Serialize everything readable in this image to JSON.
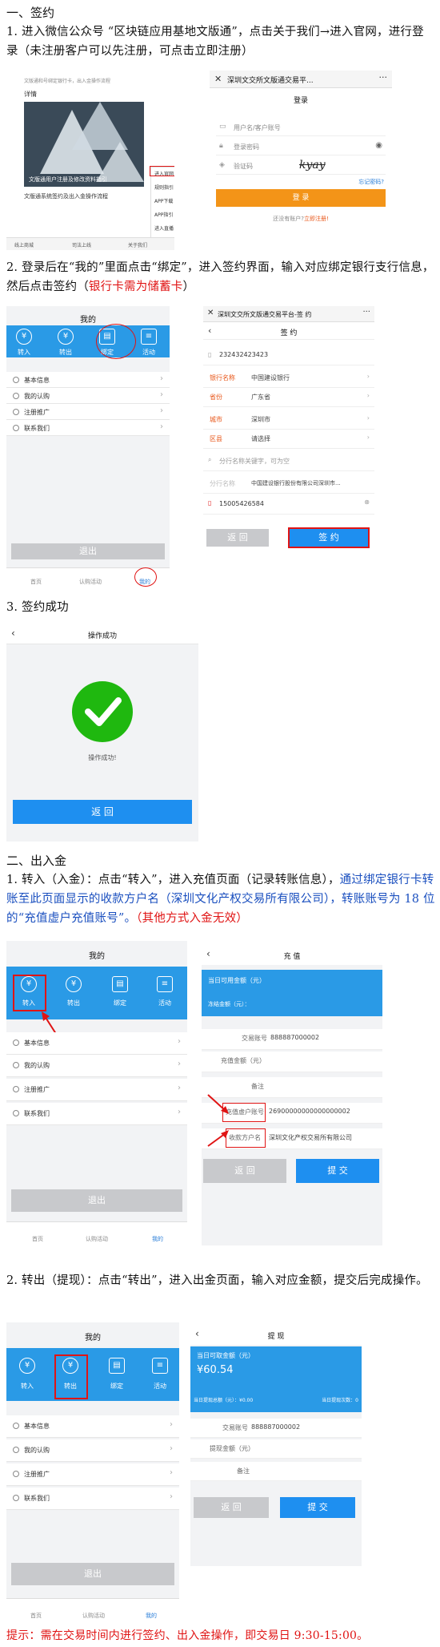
{
  "s1": {
    "heading": "一、签约",
    "p1": "1. 进入微信公众号 “区块链应用基地文版通”，点击关于我们→进入官网，进行登录（未注册客户可以先注册，可点击立即注册）",
    "p2a": "2. 登录后在“我的”里面点击“绑定”，进入签约界面，输入对应绑定银行支行信息，然后点击签约（",
    "p2red": "银行卡需为储蓄卡",
    "p2b": "）",
    "p3": "3. 签约成功"
  },
  "s2": {
    "heading": "二、出入金",
    "p1a": "1. 转入（入金）：点击“转入”，进入充值页面（记录转账信息），",
    "p1blue": "通过绑定银行卡转账至此页面显示的收款方户名（深圳文化产权交易所有限公司），转账账号为 18 位的“充值虚户充值账号”。",
    "p1red": "（其他方式入金无效）",
    "p2": "2. 转出（提现）：点击“转出”，进入出金页面，输入对应金额，提交后完成操作。"
  },
  "tip": "提示：需在交易时间内进行签约、出入金操作，即交易日 9:30-15:00。",
  "wx": {
    "line1": "文版通和号绑定银行卡，出入金操作流程",
    "detail": "详情",
    "banner": "文版通用户注册及修改资料指引",
    "sub": "文版通系统签约及出入金操作流程",
    "menu": [
      "进入官网",
      "规则指引",
      "APP下载",
      "APP指引",
      "进入直播"
    ],
    "tabs": [
      "线上商城",
      "司法上线",
      "关于我们"
    ]
  },
  "login": {
    "title": "深圳文交所文版通交易平...",
    "head": "登录",
    "user": "用户名/客户账号",
    "pwd": "登录密码",
    "code": "验证码",
    "captcha": "kyay",
    "forgot": "忘记密码?",
    "btn": "登 录",
    "reg_a": "还没有账户?",
    "reg_b": "立即注册!"
  },
  "mine": {
    "title": "我的",
    "icons": [
      "转入",
      "转出",
      "绑定",
      "活动"
    ],
    "rows": [
      "基本信息",
      "我的认购",
      "注册推广",
      "联系我们"
    ],
    "logout": "退出",
    "tabs": [
      "首页",
      "认购活动",
      "我的"
    ]
  },
  "sign": {
    "title": "深圳文交所文版通交易平台-签 约",
    "head": "签 约",
    "id": "232432423423",
    "fields": [
      [
        "银行名称",
        "中国建设银行"
      ],
      [
        "省份",
        "广东省"
      ],
      [
        "城市",
        "深圳市"
      ],
      [
        "区县",
        "请选择"
      ]
    ],
    "branch": "分行名称关键字，可为空",
    "branch_l": "分行名称",
    "branch_v": "中国建设银行股份有限公司深圳市...",
    "phone": "15005426584",
    "back": "返 回",
    "submit": "签 约"
  },
  "ok": {
    "title": "操作成功",
    "msg": "操作成功!",
    "back": "返 回"
  },
  "charge": {
    "title": "充 值",
    "avail": "当日可用金额（元）",
    "frozen": "冻结金额（元）：",
    "acct_l": "交易账号",
    "acct_v": "888887000002",
    "amt_l": "充值金额（元）",
    "note_l": "备注",
    "vact_l": "充值虚户账号",
    "vact_v": "26900000000000000002",
    "payee_l": "收款方户名",
    "payee_v": "深圳文化产权交易所有限公司",
    "back": "返 回",
    "submit": "提 交"
  },
  "withdraw": {
    "title": "提 现",
    "avail": "当日可取金额（元）",
    "amount": "¥60.54",
    "lim1": "当日提现总额（元）：¥0.00",
    "lim2": "当日提现次数：0",
    "acct_l": "交易账号",
    "acct_v": "888887000002",
    "amt_l": "提现金额（元）",
    "note_l": "备注",
    "back": "返 回",
    "submit": "提 交"
  }
}
